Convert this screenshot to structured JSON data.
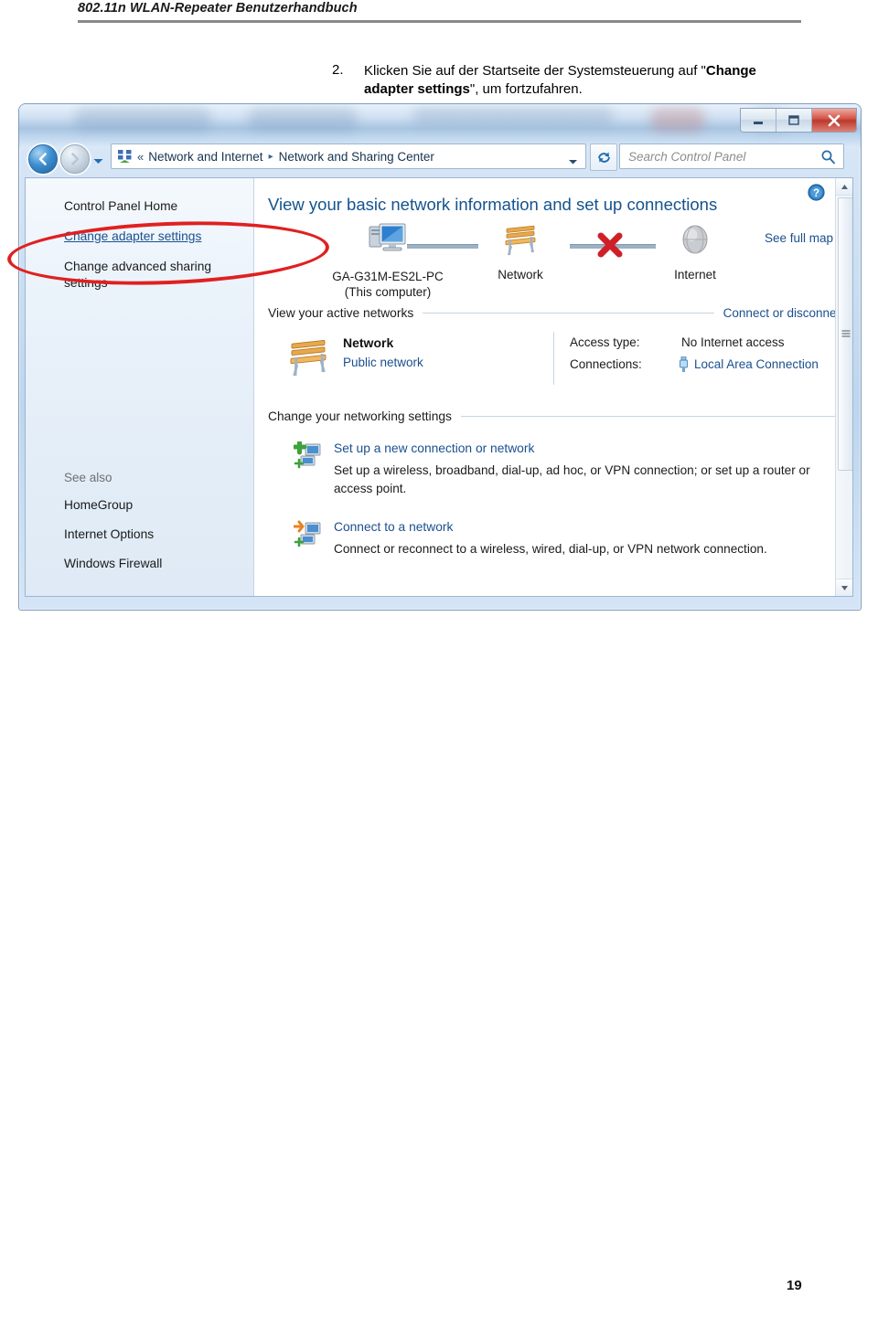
{
  "document": {
    "header_title": "802.11n  WLAN-Repeater Benutzerhandbuch",
    "page_number": "19",
    "instruction": {
      "number": "2.",
      "text_before": "Klicken Sie auf der Startseite der Systemsteuerung auf \"",
      "bold_text": "Change adapter settings",
      "text_after": "\", um fortzufahren."
    }
  },
  "window": {
    "controls": {
      "minimize": "minimize-icon",
      "maximize": "maximize-icon",
      "close": "close-icon"
    },
    "navigation": {
      "back": "back-arrow-icon",
      "forward": "forward-arrow-icon",
      "history_dropdown": "chevron-down-icon"
    },
    "breadcrumb": {
      "icon": "network-control-panel-icon",
      "overflow": "«",
      "items": [
        "Network and Internet",
        "Network and Sharing Center"
      ],
      "separator": "▸",
      "caret": "chevron-down-icon"
    },
    "refresh": {
      "icon": "refresh-icon",
      "label": "Refresh"
    },
    "search": {
      "placeholder": "Search Control Panel",
      "icon": "search-icon",
      "value": ""
    }
  },
  "sidebar": {
    "items": [
      {
        "label": "Control Panel Home",
        "link": false
      },
      {
        "label": "Change adapter settings",
        "link": true
      },
      {
        "label": "Change advanced sharing settings",
        "link": false
      }
    ],
    "see_also_heading": "See also",
    "see_also_items": [
      {
        "label": "HomeGroup"
      },
      {
        "label": "Internet Options"
      },
      {
        "label": "Windows Firewall"
      }
    ]
  },
  "content": {
    "help_icon": "help-icon",
    "heading": "View your basic network information and set up connections",
    "map": {
      "nodes": [
        {
          "icon": "computer-icon",
          "label_line1": "GA-G31M-ES2L-PC",
          "label_line2": "(This computer)"
        },
        {
          "icon": "network-bench-icon",
          "label_line1": "Network",
          "label_line2": ""
        },
        {
          "icon": "internet-globe-icon",
          "label_line1": "Internet",
          "label_line2": ""
        }
      ],
      "link_broken_icon": "red-x-icon",
      "see_full_map": "See full map"
    },
    "active_networks": {
      "heading": "View your active networks",
      "action_link": "Connect or disconnect",
      "network": {
        "icon": "network-bench-icon",
        "name": "Network",
        "type": "Public network",
        "access_type_label": "Access type:",
        "access_type_value": "No Internet access",
        "connections_label": "Connections:",
        "connections_icon": "network-cable-icon",
        "connections_value": "Local Area Connection"
      }
    },
    "networking_settings": {
      "heading": "Change your networking settings",
      "tasks": [
        {
          "icon": "new-connection-icon",
          "title": "Set up a new connection or network",
          "description": "Set up a wireless, broadband, dial-up, ad hoc, or VPN connection; or set up a router or access point."
        },
        {
          "icon": "connect-network-icon",
          "title": "Connect to a network",
          "description": "Connect or reconnect to a wireless, wired, dial-up, or VPN network connection."
        }
      ]
    },
    "scrollbar": {
      "up_icon": "scroll-up-icon",
      "down_icon": "scroll-down-icon",
      "grip_icon": "scroll-grip-icon"
    }
  },
  "annotation": {
    "shape": "ellipse",
    "color": "#e02020",
    "targets": "Change adapter settings"
  }
}
